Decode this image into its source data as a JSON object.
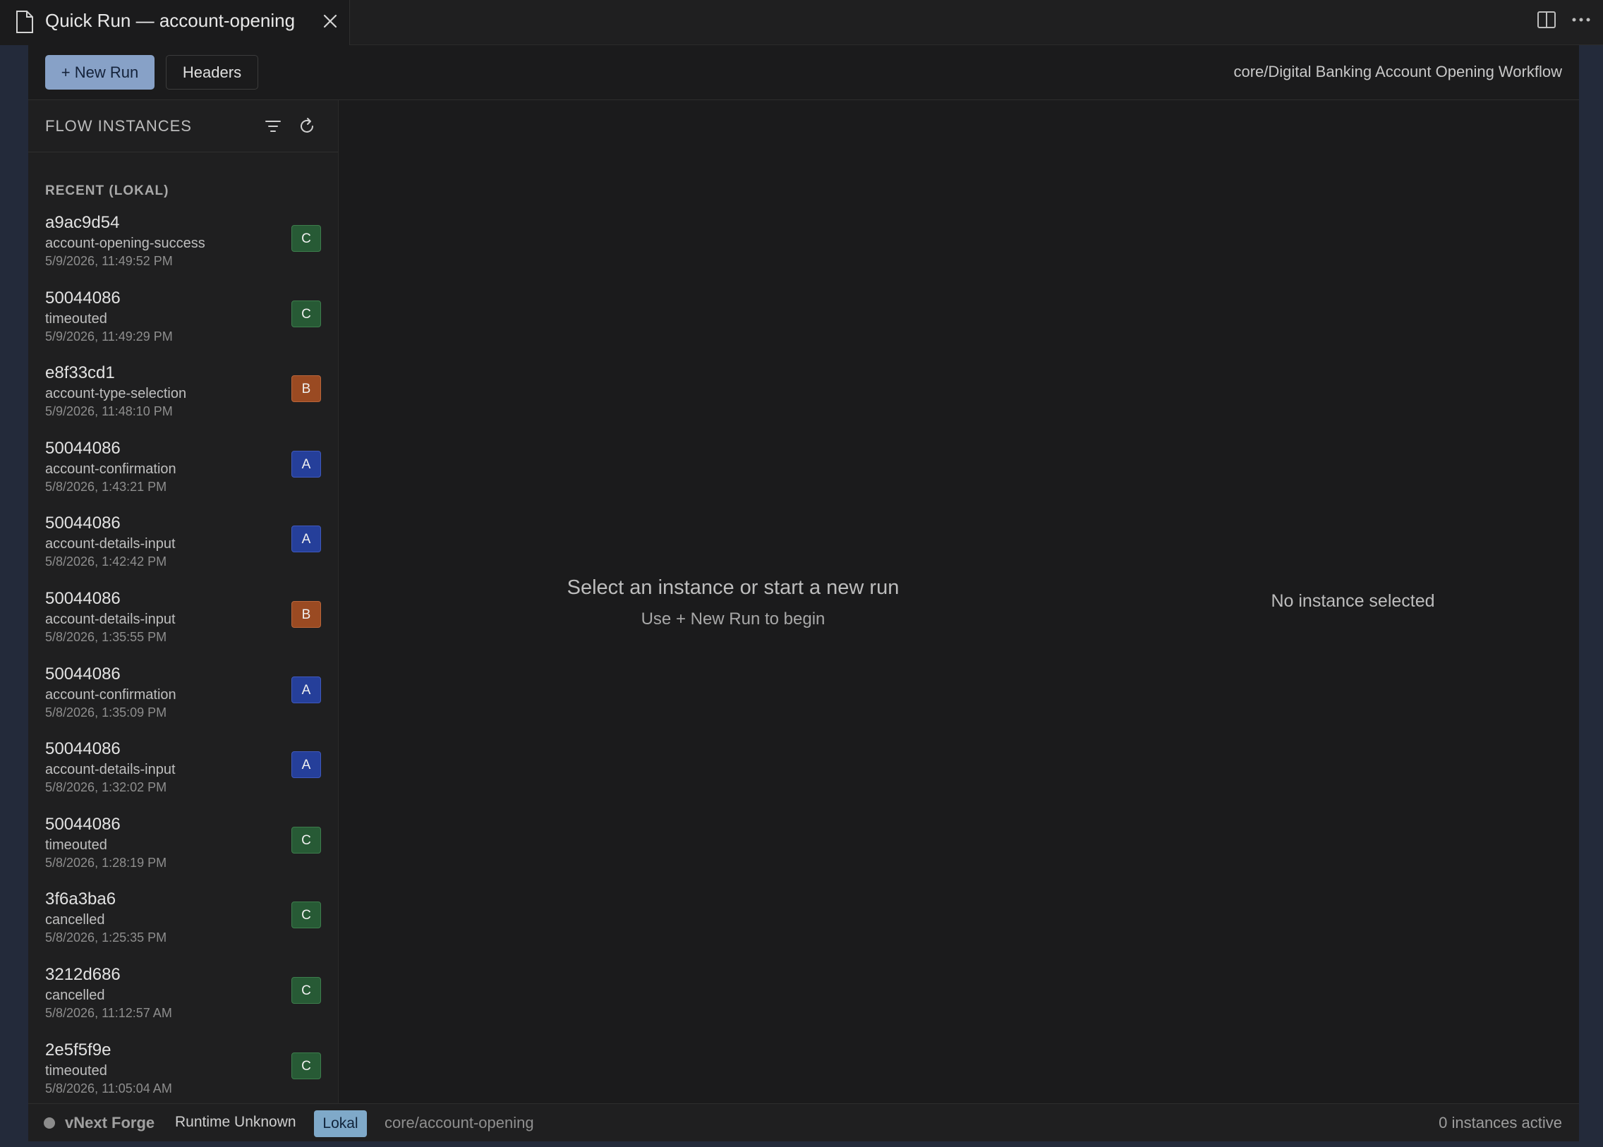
{
  "tab": {
    "title": "Quick Run — account-opening"
  },
  "toolbar": {
    "new_run_label": "+ New Run",
    "headers_label": "Headers",
    "flow_path": "core/Digital Banking Account Opening Workflow"
  },
  "sidebar": {
    "title": "FLOW INSTANCES",
    "section_label": "RECENT (LOKAL)",
    "items": [
      {
        "id": "a9ac9d54",
        "state": "account-opening-success",
        "time": "5/9/2026, 11:49:52 PM",
        "badge": "C"
      },
      {
        "id": "50044086",
        "state": "timeouted",
        "time": "5/9/2026, 11:49:29 PM",
        "badge": "C"
      },
      {
        "id": "e8f33cd1",
        "state": "account-type-selection",
        "time": "5/9/2026, 11:48:10 PM",
        "badge": "B"
      },
      {
        "id": "50044086",
        "state": "account-confirmation",
        "time": "5/8/2026, 1:43:21 PM",
        "badge": "A"
      },
      {
        "id": "50044086",
        "state": "account-details-input",
        "time": "5/8/2026, 1:42:42 PM",
        "badge": "A"
      },
      {
        "id": "50044086",
        "state": "account-details-input",
        "time": "5/8/2026, 1:35:55 PM",
        "badge": "B"
      },
      {
        "id": "50044086",
        "state": "account-confirmation",
        "time": "5/8/2026, 1:35:09 PM",
        "badge": "A"
      },
      {
        "id": "50044086",
        "state": "account-details-input",
        "time": "5/8/2026, 1:32:02 PM",
        "badge": "A"
      },
      {
        "id": "50044086",
        "state": "timeouted",
        "time": "5/8/2026, 1:28:19 PM",
        "badge": "C"
      },
      {
        "id": "3f6a3ba6",
        "state": "cancelled",
        "time": "5/8/2026, 1:25:35 PM",
        "badge": "C"
      },
      {
        "id": "3212d686",
        "state": "cancelled",
        "time": "5/8/2026, 11:12:57 AM",
        "badge": "C"
      },
      {
        "id": "2e5f5f9e",
        "state": "timeouted",
        "time": "5/8/2026, 11:05:04 AM",
        "badge": "C"
      }
    ]
  },
  "main": {
    "empty_title": "Select an instance or start a new run",
    "empty_subtitle": "Use + New Run to begin",
    "no_instance": "No instance selected"
  },
  "status": {
    "brand": "vNext Forge",
    "runtime": "Runtime Unknown",
    "env": "Lokal",
    "path": "core/account-opening",
    "active": "0 instances active"
  },
  "colors": {
    "badge_C": "#275a35",
    "badge_B": "#9a4a22",
    "badge_A": "#253f9a",
    "accent": "#87a1c7",
    "env_chip": "#7fa9c9"
  }
}
